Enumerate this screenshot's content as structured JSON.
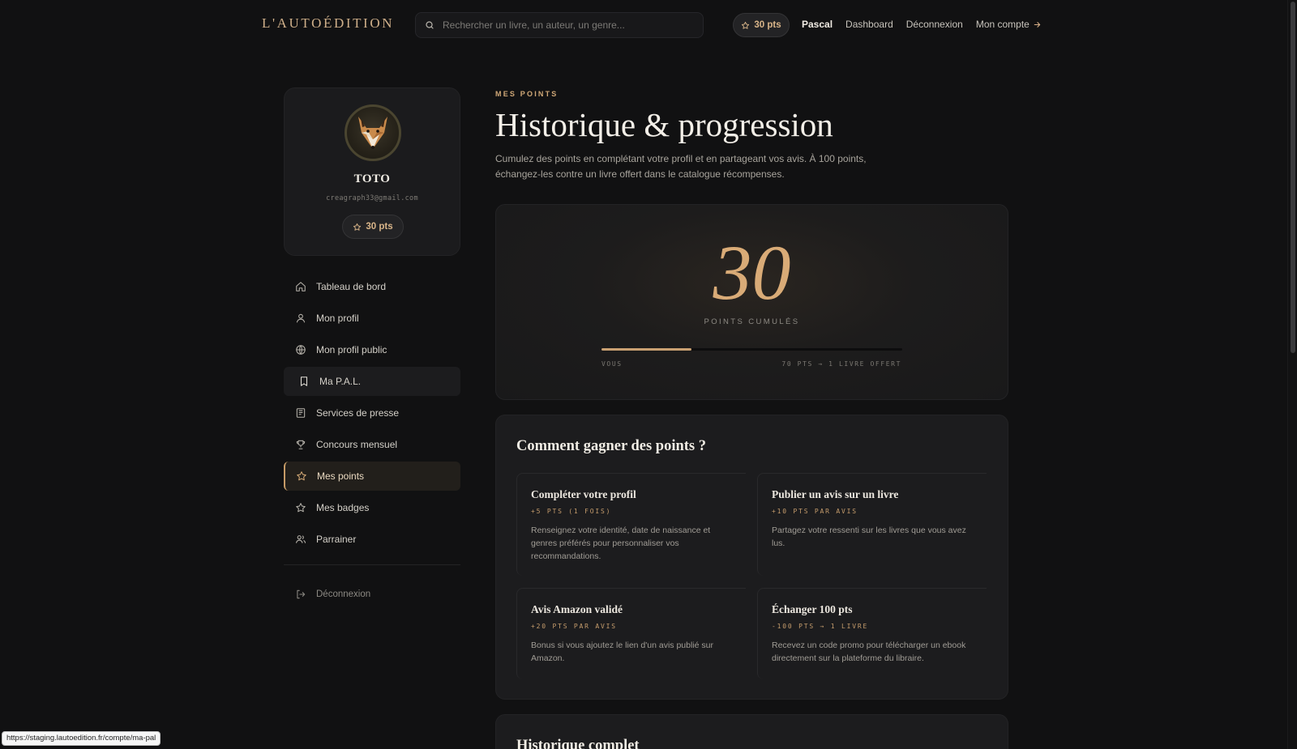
{
  "header": {
    "logo": "L'AUTOÉDITION",
    "search_placeholder": "Rechercher un livre, un auteur, un genre...",
    "points": "30 pts",
    "user": "Pascal",
    "links": {
      "dashboard": "Dashboard",
      "logout": "Déconnexion",
      "account": "Mon compte"
    }
  },
  "profile": {
    "name": "TOTO",
    "email": "creagraph33@gmail.com",
    "points": "30 pts"
  },
  "sidebar": {
    "items": [
      {
        "label": "Tableau de bord",
        "icon": "home-icon"
      },
      {
        "label": "Mon profil",
        "icon": "user-icon"
      },
      {
        "label": "Mon profil public",
        "icon": "globe-icon"
      },
      {
        "label": "Ma P.A.L.",
        "icon": "bookmark-icon"
      },
      {
        "label": "Services de presse",
        "icon": "newspaper-icon"
      },
      {
        "label": "Concours mensuel",
        "icon": "trophy-icon"
      },
      {
        "label": "Mes points",
        "icon": "star-icon"
      },
      {
        "label": "Mes badges",
        "icon": "star-icon"
      },
      {
        "label": "Parrainer",
        "icon": "users-icon"
      }
    ],
    "logout": "Déconnexion",
    "active": "Mes points"
  },
  "main": {
    "eyebrow": "MES POINTS",
    "title": "Historique & progression",
    "description": "Cumulez des points en complétant votre profil et en partageant vos avis. À 100 points, échangez-les contre un livre offert dans le catalogue récompenses.",
    "points_card": {
      "value": "30",
      "label": "POINTS CUMULÉS",
      "progress_fraction": 0.3,
      "left_label": "VOUS",
      "right_label": "70 PTS → 1 LIVRE OFFERT"
    },
    "earn": {
      "title": "Comment gagner des points ?",
      "items": [
        {
          "title": "Compléter votre profil",
          "tag": "+5 PTS (1 FOIS)",
          "text": "Renseignez votre identité, date de naissance et genres préférés pour personnaliser vos recommandations."
        },
        {
          "title": "Publier un avis sur un livre",
          "tag": "+10 PTS PAR AVIS",
          "text": "Partagez votre ressenti sur les livres que vous avez lus."
        },
        {
          "title": "Avis Amazon validé",
          "tag": "+20 PTS PAR AVIS",
          "text": "Bonus si vous ajoutez le lien d'un avis publié sur Amazon."
        },
        {
          "title": "Échanger 100 pts",
          "tag": "-100 PTS → 1 LIVRE",
          "text": "Recevez un code promo pour télécharger un ebook directement sur la plateforme du libraire."
        }
      ]
    },
    "history_title": "Historique complet"
  },
  "status_url": "https://staging.lautoedition.fr/compte/ma-pal",
  "colors": {
    "accent": "#c9a072",
    "background": "#111112",
    "card": "#1c1c1e"
  }
}
